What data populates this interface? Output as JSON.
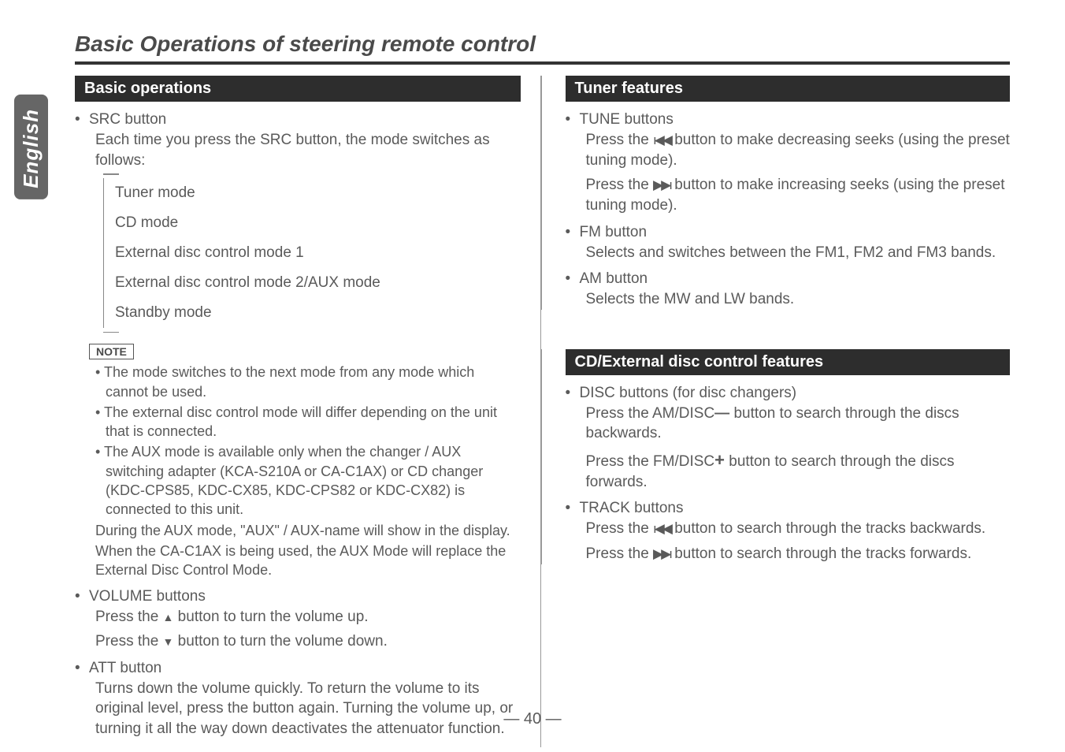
{
  "sideTab": "English",
  "mainTitle": "Basic Operations of steering remote control",
  "pageNum": "— 40 —",
  "left": {
    "sectionTitle": "Basic operations",
    "src": {
      "head": "SRC button",
      "intro": "Each time you press the SRC button, the mode switches as follows:",
      "modes": [
        "Tuner mode",
        "CD mode",
        "External disc control mode 1",
        "External disc control mode 2/AUX mode",
        "Standby mode"
      ]
    },
    "noteLabel": "NOTE",
    "notes": [
      "The mode switches to the next mode from any mode which cannot be used.",
      "The external disc control mode will differ depending on the unit that is connected.",
      "The AUX mode is available only when the changer / AUX switching adapter (KCA-S210A or CA-C1AX) or CD changer (KDC-CPS85, KDC-CX85, KDC-CPS82 or KDC-CX82) is connected to this unit."
    ],
    "noteExtra1": "During the AUX mode, \"AUX\" / AUX-name will show in the display.",
    "noteExtra2": "When the CA-C1AX is being used, the AUX Mode will replace the External Disc Control Mode.",
    "volume": {
      "head": "VOLUME buttons",
      "up_pre": "Press the ",
      "up_post": " button to turn the volume up.",
      "down_pre": "Press the ",
      "down_post": " button to turn the volume down."
    },
    "att": {
      "head": "ATT button",
      "body": "Turns down the volume quickly. To return the volume to its original level, press the button again. Turning the volume up, or turning it all the way down deactivates the attenuator function."
    }
  },
  "rightTuner": {
    "sectionTitle": "Tuner features",
    "tune": {
      "head": "TUNE buttons",
      "dec_pre": "Press the ",
      "dec_post": " button to make decreasing seeks (using the preset tuning mode).",
      "inc_pre": "Press the ",
      "inc_post": " button to make increasing seeks (using the preset tuning mode)."
    },
    "fm": {
      "head": "FM button",
      "body": "Selects and switches between the FM1, FM2 and FM3 bands."
    },
    "am": {
      "head": "AM button",
      "body": "Selects the MW and LW bands."
    }
  },
  "rightCD": {
    "sectionTitle": "CD/External disc control features",
    "disc": {
      "head": "DISC buttons (for disc changers)",
      "back_pre": "Press the AM/DISC",
      "back_post": " button to search through the discs backwards.",
      "fwd_pre": "Press the FM/DISC",
      "fwd_post": " button to search through the discs forwards."
    },
    "track": {
      "head": "TRACK buttons",
      "back_pre": "Press the ",
      "back_post": " button to search through the tracks backwards.",
      "fwd_pre": "Press the ",
      "fwd_post": " button to search through the tracks forwards."
    }
  }
}
